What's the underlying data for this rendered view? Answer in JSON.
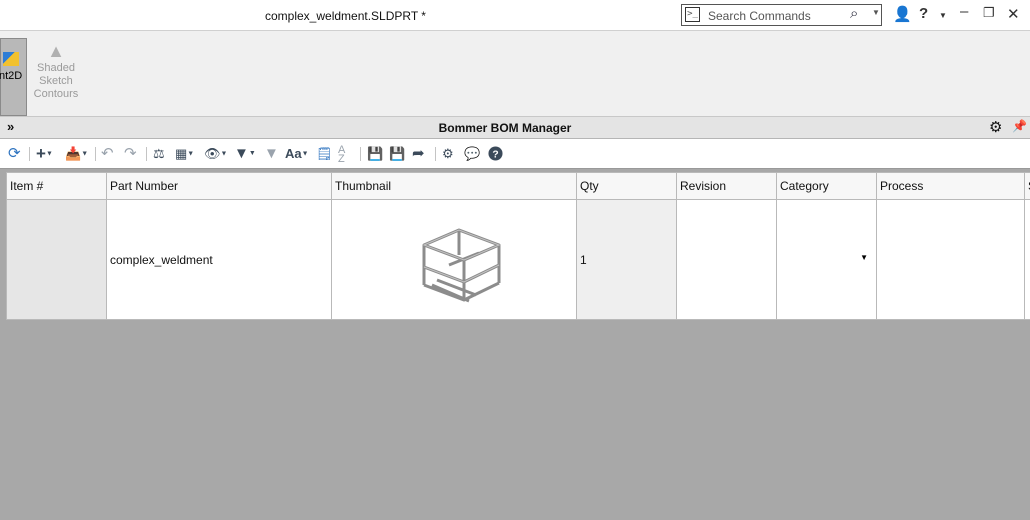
{
  "window": {
    "title": "complex_weldment.SLDPRT *",
    "search_placeholder": "Search Commands",
    "icons": [
      "terminal-icon",
      "search-icon",
      "user-icon",
      "help-icon",
      "minimize-icon",
      "restore-icon",
      "close-icon"
    ]
  },
  "ribbon": {
    "active_partial_label": "nt2D",
    "shaded_sketch_contours_label": "Shaded Sketch Contours"
  },
  "panel": {
    "title": "Bommer BOM Manager"
  },
  "toolbar": {
    "icons": [
      "refresh-icon",
      "add-icon",
      "import-icon",
      "undo-icon",
      "redo-icon",
      "level-icon",
      "grid-icon",
      "view-icon",
      "filter-icon",
      "clear-filter-icon",
      "font-icon",
      "notes-icon",
      "sort-icon",
      "save-icon",
      "save-as-icon",
      "share-icon",
      "settings-icon",
      "comment-icon",
      "help-icon"
    ],
    "font_label": "Aa"
  },
  "table": {
    "columns": [
      "Item #",
      "Part Number",
      "Thumbnail",
      "Qty",
      "Revision",
      "Category",
      "Process",
      "S"
    ],
    "rows": [
      {
        "item": "",
        "part_number": "complex_weldment",
        "thumbnail": "weldment frame",
        "qty": "1",
        "revision": "",
        "category": "",
        "process": ""
      }
    ]
  }
}
